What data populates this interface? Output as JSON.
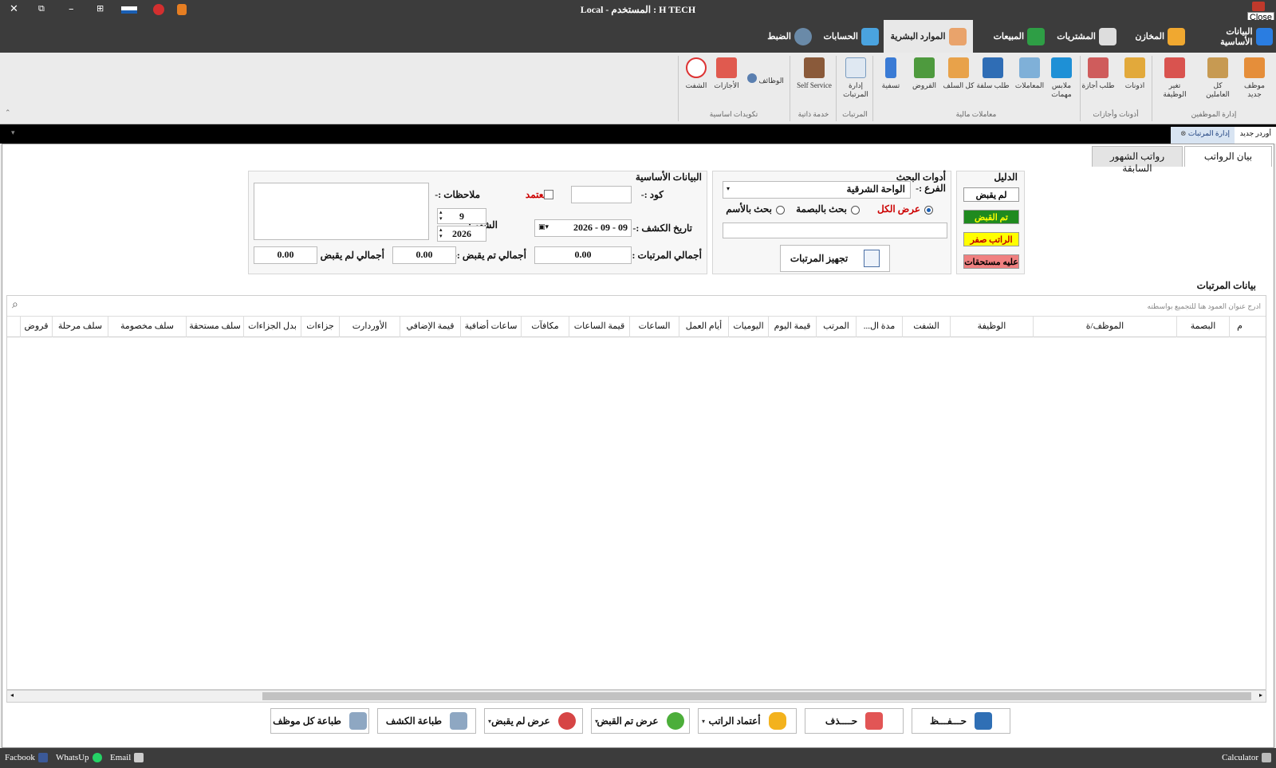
{
  "window": {
    "title": "H TECH : المستخدم   -   Local",
    "close_tooltip": "Close"
  },
  "menu_tabs": [
    {
      "label": "البيانات الأساسية",
      "icon": "globe-grid-icon"
    },
    {
      "label": "المخازن",
      "icon": "warehouse-icon"
    },
    {
      "label": "المشتريات",
      "icon": "purchase-doc-icon"
    },
    {
      "label": "المبيعات",
      "icon": "sales-money-icon"
    },
    {
      "label": "الموارد البشرية",
      "icon": "hr-people-icon",
      "active": true
    },
    {
      "label": "الحسابات",
      "icon": "accounts-dollar-icon"
    },
    {
      "label": "الضبط",
      "icon": "gear-icon"
    }
  ],
  "ribbon": {
    "buttons": [
      {
        "label": "موظف جديد",
        "icon": "add-employee-icon"
      },
      {
        "label": "كل العاملين",
        "icon": "all-employees-icon"
      },
      {
        "label": "تغير الوظيفة",
        "icon": "change-job-icon"
      },
      {
        "label": "اذونات",
        "icon": "permissions-icon"
      },
      {
        "label": "طلب أجازة",
        "icon": "leave-request-icon"
      },
      {
        "label": "ملابس مهمات",
        "icon": "uniform-icon"
      },
      {
        "label": "المعاملات",
        "icon": "transactions-icon"
      },
      {
        "label": "طلب سلفة",
        "icon": "advance-request-icon"
      },
      {
        "label": "كل السلف",
        "icon": "all-advances-icon"
      },
      {
        "label": "القروض",
        "icon": "loans-icon"
      },
      {
        "label": "تسفية",
        "icon": "settlement-icon"
      },
      {
        "label": "إدارة المرتبات",
        "icon": "payroll-management-icon"
      },
      {
        "label": "Self Service",
        "icon": "self-service-icon"
      },
      {
        "label": "الوظائف",
        "icon": "jobs-icon"
      },
      {
        "label": "الأجازات",
        "icon": "holidays-icon"
      },
      {
        "label": "الشفت",
        "icon": "shift-clock-icon"
      }
    ],
    "groups": [
      "إدارة الموظفين",
      "أذونات وأجازات",
      "معاملات مالية",
      "المرتبات",
      "خدمة ذاتية",
      "تكويدات اساسية"
    ]
  },
  "doc_tabs": [
    "أوردر جديد",
    "إدارة المرتبات"
  ],
  "sub_tabs": [
    "بيان الرواتب",
    "رواتب الشهور السابقة"
  ],
  "legend": {
    "title": "الدليل",
    "items": [
      {
        "label": "لم يقبض",
        "bg": "#ffffff",
        "fg": "#000000"
      },
      {
        "label": "تم القبض",
        "bg": "#1f8a1f",
        "fg": "#ffff00"
      },
      {
        "label": "الراتب صفر",
        "bg": "#ffff00",
        "fg": "#c00000"
      },
      {
        "label": "عليه مستحقات",
        "bg": "#f08080",
        "fg": "#000000"
      }
    ]
  },
  "search_tools": {
    "title": "أدوات البحث",
    "branch_label": "الفرع :-",
    "branch_value": "الواحة الشرقية",
    "radio_all": "عرض الكل",
    "radio_fingerprint": "بحث بالبصمة",
    "radio_name": "بحث بالأسم",
    "prepare_button": "تجهيز المرتبات"
  },
  "basic_data": {
    "title": "البيانات الأساسية",
    "code_label": "كود :-",
    "code_value": "",
    "approved_label": "معتمد",
    "notes_label": "ملاحظات :-",
    "sheet_date_label": "تاريخ الكشف :-",
    "sheet_date_value": "09 - 09 - 2026",
    "month_label": "الشهر :",
    "month_value": "9",
    "year_value": "2026",
    "total_salaries_label": "أجمالي المرتبات :-",
    "total_salaries_value": "0.00",
    "total_paid_label": "أجمالي تم يقبض :-",
    "total_paid_value": "0.00",
    "total_unpaid_label": "أجمالي لم يقبض :-",
    "total_unpaid_value": "0.00"
  },
  "grid": {
    "title": "بيانات المرتبات",
    "group_hint": "ادرج عنوان العمود هنا للتجميع بواسطته",
    "columns": [
      "م",
      "البصمة",
      "الموظف/ة",
      "الوظيفة",
      "الشفت",
      "مدة ال...",
      "المرتب",
      "قيمة اليوم",
      "اليوميات",
      "أيام العمل",
      "الساعات",
      "قيمة الساعات",
      "مكافآت",
      "ساعات أضافية",
      "قيمة الإضافي",
      "الأوردارت",
      "جزاءات",
      "بدل الجزاءات",
      "سلف مستحقة",
      "سلف مخصومة",
      "سلف مرحلة",
      "قروض"
    ]
  },
  "bottom_buttons": [
    {
      "label": "حـــفـــظ",
      "icon": "save-floppy-icon"
    },
    {
      "label": "حــــذف",
      "icon": "delete-icon"
    },
    {
      "label": "أعتماد الراتب",
      "icon": "lock-icon"
    },
    {
      "label": "عرض تم القبض",
      "icon": "check-green-icon"
    },
    {
      "label": "عرض لم يقبض",
      "icon": "x-red-icon"
    },
    {
      "label": "طباعة الكشف",
      "icon": "printer-icon"
    },
    {
      "label": "طباعة كل موظف",
      "icon": "printer-icon"
    }
  ],
  "status_bar": {
    "facebook": "Facbook",
    "whatsapp": "WhatsUp",
    "email": "Email",
    "calculator": "Calculator"
  }
}
